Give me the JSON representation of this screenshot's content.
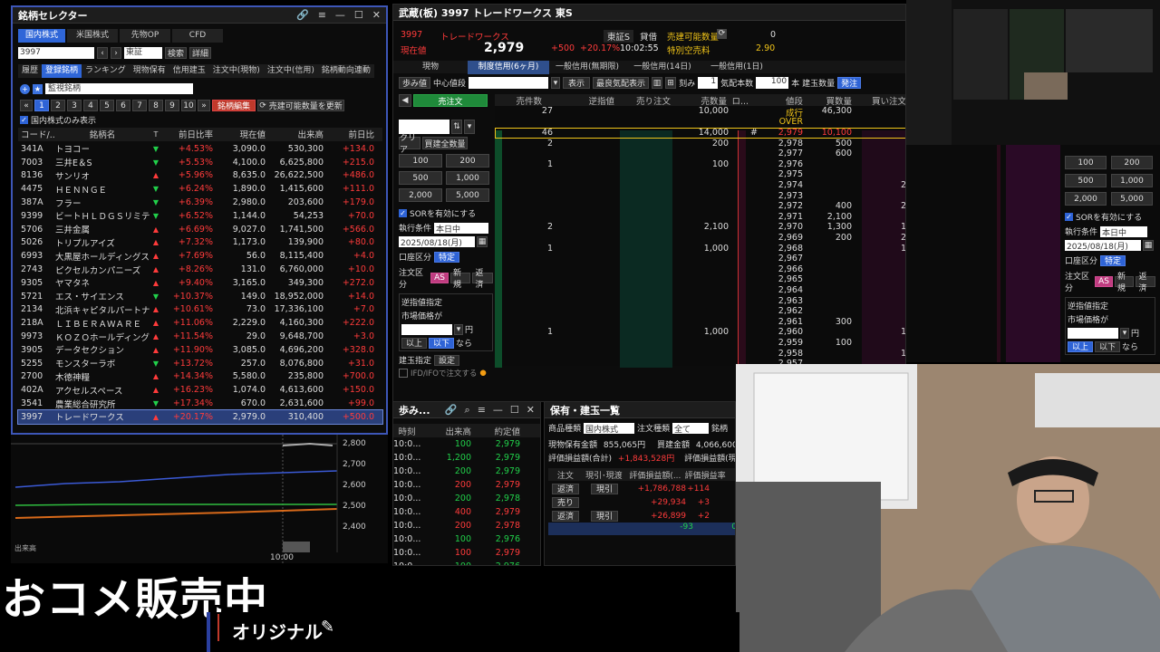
{
  "selector": {
    "title": "銘柄セレクター",
    "tabs": [
      "国内株式",
      "米国株式",
      "先物OP",
      "CFD"
    ],
    "code_input": "3997",
    "market_select": "東証",
    "search_btn": "検索",
    "detail_btn": "詳細",
    "subtabs": [
      "履歴",
      "登録銘柄",
      "ランキング",
      "現物保有",
      "信用建玉",
      "注文中(現物)",
      "注文中(信用)",
      "銘柄動向連動"
    ],
    "list_select": "監視銘柄",
    "pages": [
      "1",
      "2",
      "3",
      "4",
      "5",
      "6",
      "7",
      "8",
      "9",
      "10"
    ],
    "edit_btn": "銘柄編集",
    "refresh_btn": "売建可能数量を更新",
    "domestic_only": "国内株式のみ表示",
    "headers": [
      "コード/...",
      "銘柄名",
      "T",
      "前日比率",
      "現在値",
      "出来高",
      "前日比"
    ],
    "rows": [
      {
        "code": "341A",
        "name": "トヨコー",
        "dir": "down",
        "chg": "+4.53%",
        "price": "3,090.0",
        "vol": "530,300",
        "prev": "+134.0"
      },
      {
        "code": "7003",
        "name": "三井E＆S",
        "dir": "down",
        "chg": "+5.53%",
        "price": "4,100.0",
        "vol": "6,625,800",
        "prev": "+215.0"
      },
      {
        "code": "8136",
        "name": "サンリオ",
        "dir": "up",
        "chg": "+5.96%",
        "price": "8,635.0",
        "vol": "26,622,500",
        "prev": "+486.0"
      },
      {
        "code": "4475",
        "name": "ＨＥＮＮＧＥ",
        "dir": "down",
        "chg": "+6.24%",
        "price": "1,890.0",
        "vol": "1,415,600",
        "prev": "+111.0"
      },
      {
        "code": "387A",
        "name": "フラー",
        "dir": "down",
        "chg": "+6.39%",
        "price": "2,980.0",
        "vol": "203,600",
        "prev": "+179.0"
      },
      {
        "code": "9399",
        "name": "ビートＨＬＤＧＳリミテ...",
        "dir": "down",
        "chg": "+6.52%",
        "price": "1,144.0",
        "vol": "54,253",
        "prev": "+70.0"
      },
      {
        "code": "5706",
        "name": "三井金属",
        "dir": "up",
        "chg": "+6.69%",
        "price": "9,027.0",
        "vol": "1,741,500",
        "prev": "+566.0"
      },
      {
        "code": "5026",
        "name": "トリプルアイズ",
        "dir": "up",
        "chg": "+7.32%",
        "price": "1,173.0",
        "vol": "139,900",
        "prev": "+80.0"
      },
      {
        "code": "6993",
        "name": "大黒屋ホールディングス",
        "dir": "up",
        "chg": "+7.69%",
        "price": "56.0",
        "vol": "8,115,400",
        "prev": "+4.0"
      },
      {
        "code": "2743",
        "name": "ピクセルカンパニーズ",
        "dir": "up",
        "chg": "+8.26%",
        "price": "131.0",
        "vol": "6,760,000",
        "prev": "+10.0"
      },
      {
        "code": "9305",
        "name": "ヤマタネ",
        "dir": "up",
        "chg": "+9.40%",
        "price": "3,165.0",
        "vol": "349,300",
        "prev": "+272.0"
      },
      {
        "code": "5721",
        "name": "エス・サイエンス",
        "dir": "down",
        "chg": "+10.37%",
        "price": "149.0",
        "vol": "18,952,000",
        "prev": "+14.0"
      },
      {
        "code": "2134",
        "name": "北浜キャピタルパートナー...",
        "dir": "up",
        "chg": "+10.61%",
        "price": "73.0",
        "vol": "17,336,100",
        "prev": "+7.0"
      },
      {
        "code": "218A",
        "name": "ＬＩＢＥＲＡＷＡＲＥ",
        "dir": "up",
        "chg": "+11.06%",
        "price": "2,229.0",
        "vol": "4,160,300",
        "prev": "+222.0"
      },
      {
        "code": "9973",
        "name": "ＫＯＺＯホールディングス",
        "dir": "up",
        "chg": "+11.54%",
        "price": "29.0",
        "vol": "9,648,700",
        "prev": "+3.0"
      },
      {
        "code": "3905",
        "name": "データセクション",
        "dir": "up",
        "chg": "+11.90%",
        "price": "3,085.0",
        "vol": "4,696,200",
        "prev": "+328.0"
      },
      {
        "code": "5255",
        "name": "モンスターラボ",
        "dir": "down",
        "chg": "+13.72%",
        "price": "257.0",
        "vol": "8,076,800",
        "prev": "+31.0"
      },
      {
        "code": "2700",
        "name": "木徳神糧",
        "dir": "up",
        "chg": "+14.34%",
        "price": "5,580.0",
        "vol": "235,800",
        "prev": "+700.0"
      },
      {
        "code": "402A",
        "name": "アクセルスペース",
        "dir": "up",
        "chg": "+16.23%",
        "price": "1,074.0",
        "vol": "4,613,600",
        "prev": "+150.0"
      },
      {
        "code": "3541",
        "name": "農業総合研究所",
        "dir": "down",
        "chg": "+17.34%",
        "price": "670.0",
        "vol": "2,631,600",
        "prev": "+99.0"
      },
      {
        "code": "3997",
        "name": "トレードワークス",
        "dir": "up",
        "chg": "+20.17%",
        "price": "2,979.0",
        "vol": "310,400",
        "prev": "+500.0"
      }
    ]
  },
  "minichart": {
    "ticks": [
      "2,800",
      "2,700",
      "2,600",
      "2,500",
      "2,400"
    ],
    "time": "10:00",
    "vol_label": "出来高"
  },
  "board": {
    "title": "武蔵(板) 3997 トレードワークス 東S",
    "code": "3997",
    "name": "トレードワークス",
    "market": "東証S",
    "price_label": "現在値",
    "price": "2,979",
    "change": "+500",
    "change_pct": "+20.17%",
    "time": "10:02:55",
    "lend_label": "貸借",
    "sell_label": "売建可能数量",
    "sell_qty": "0",
    "special_label": "特別空売料",
    "special_rate": "2.90",
    "tabs": [
      "現物",
      "制度信用(6ヶ月)",
      "一般信用(無期限)",
      "一般信用(14日)",
      "一般信用(1日)"
    ],
    "toolbar": {
      "ayumi": "歩み値",
      "center": "中心値段",
      "display": "表示",
      "best": "最良気配表示",
      "step": "刻み",
      "step_val": "1",
      "qty_label": "気配本数",
      "qty_val": "100",
      "unit": "本",
      "close": "建玉数量",
      "oneclick": "発注"
    },
    "sell_order": "売注文",
    "headers": [
      "売件数",
      "逆指値",
      "売り注文",
      "売数量",
      "ロ...",
      "値段",
      "買数量",
      "買い注文"
    ],
    "market_row": {
      "sell_cnt": "27",
      "sell_qty": "10,000",
      "price": "成行",
      "buy_qty": "46,300"
    },
    "over": "OVER",
    "levels": [
      {
        "sc": "46",
        "sq": "14,000",
        "p": "2,979",
        "bq": "10,100"
      },
      {
        "sc": "2",
        "sq": "200",
        "p": "2,978",
        "bq": "500"
      },
      {
        "sc": "",
        "sq": "",
        "p": "2,977",
        "bq": "600"
      },
      {
        "sc": "1",
        "sq": "100",
        "p": "2,976",
        "bq": ""
      },
      {
        "sc": "",
        "sq": "",
        "p": "2,975",
        "bq": ""
      },
      {
        "sc": "",
        "sq": "",
        "p": "2,974",
        "bq": ""
      },
      {
        "sc": "",
        "sq": "",
        "p": "2,973",
        "bq": ""
      },
      {
        "sc": "",
        "sq": "",
        "p": "2,972",
        "bq": "400"
      },
      {
        "sc": "",
        "sq": "",
        "p": "2,971",
        "bq": "2,100"
      },
      {
        "sc": "2",
        "sq": "2,100",
        "p": "2,970",
        "bq": "1,300"
      },
      {
        "sc": "",
        "sq": "",
        "p": "2,969",
        "bq": "200"
      },
      {
        "sc": "1",
        "sq": "1,000",
        "p": "2,968",
        "bq": ""
      },
      {
        "sc": "",
        "sq": "",
        "p": "2,967",
        "bq": ""
      },
      {
        "sc": "",
        "sq": "",
        "p": "2,966",
        "bq": ""
      },
      {
        "sc": "",
        "sq": "",
        "p": "2,965",
        "bq": ""
      },
      {
        "sc": "",
        "sq": "",
        "p": "2,964",
        "bq": ""
      },
      {
        "sc": "",
        "sq": "",
        "p": "2,963",
        "bq": ""
      },
      {
        "sc": "",
        "sq": "",
        "p": "2,962",
        "bq": ""
      },
      {
        "sc": "",
        "sq": "",
        "p": "2,961",
        "bq": "300"
      },
      {
        "sc": "1",
        "sq": "1,000",
        "p": "2,960",
        "bq": ""
      },
      {
        "sc": "",
        "sq": "",
        "p": "2,959",
        "bq": "100"
      },
      {
        "sc": "",
        "sq": "",
        "p": "2,958",
        "bq": ""
      },
      {
        "sc": "",
        "sq": "",
        "p": "2,957",
        "bq": ""
      }
    ],
    "buy_cnt": [
      "2",
      "2",
      "1",
      "2",
      "1",
      "1",
      "1"
    ],
    "clear_btn": "クリア",
    "all_qty_btn": "買建全数量",
    "qty_btns": [
      "100",
      "200",
      "500",
      "1,000",
      "2,000",
      "5,000"
    ],
    "sor": "SORを有効にする",
    "cond_label": "執行条件",
    "cond_val": "本日中",
    "date_val": "2025/08/18(月)",
    "acct_label": "口座区分",
    "acct_val": "特定",
    "ord_label": "注文区分",
    "ord_as": "AS",
    "ord_new": "新規",
    "ord_close": "返済",
    "stop_label": "逆指値指定",
    "mkt_price": "市場価格が",
    "yen": "円",
    "above": "以上",
    "below": "以下",
    "nara": "なら",
    "pos_label": "建玉指定",
    "pos_btn": "設定",
    "ifd": "IFD/IFOで注文する"
  },
  "ticks": {
    "title": "歩み...",
    "headers": [
      "時刻",
      "出来高",
      "約定値"
    ],
    "rows": [
      {
        "t": "10:0...",
        "v": "100",
        "p": "2,979",
        "c": "green"
      },
      {
        "t": "10:0...",
        "v": "1,200",
        "p": "2,979",
        "c": "green"
      },
      {
        "t": "10:0...",
        "v": "200",
        "p": "2,979",
        "c": "green"
      },
      {
        "t": "10:0...",
        "v": "200",
        "p": "2,979",
        "c": "red"
      },
      {
        "t": "10:0...",
        "v": "200",
        "p": "2,978",
        "c": "green"
      },
      {
        "t": "10:0...",
        "v": "400",
        "p": "2,979",
        "c": "red"
      },
      {
        "t": "10:0...",
        "v": "200",
        "p": "2,978",
        "c": "red"
      },
      {
        "t": "10:0...",
        "v": "100",
        "p": "2,976",
        "c": "green"
      },
      {
        "t": "10:0...",
        "v": "100",
        "p": "2,979",
        "c": "red"
      },
      {
        "t": "10:0...",
        "v": "100",
        "p": "2,976",
        "c": "green"
      }
    ]
  },
  "holdings": {
    "title": "保有・建玉一覧",
    "kind_label": "商品種類",
    "kind_val": "国内株式",
    "ordtype_label": "注文種類",
    "ordtype_val": "全て",
    "stock_label": "銘柄",
    "cash_label": "現物保有金額",
    "cash_val": "855,065円",
    "buy_label": "買建金額",
    "buy_val": "4,066,600",
    "pl_label": "評価損益額(合計)",
    "pl_val": "+1,843,528円",
    "pl_label2": "評価損益額(現",
    "headers": [
      "注文",
      "現引･現渡",
      "評価損益額(...",
      "評価損益率"
    ],
    "rows": [
      {
        "a": "返済",
        "b": "現引",
        "c": "+1,786,788",
        "d": "+114"
      },
      {
        "a": "売り",
        "b": "",
        "c": "+29,934",
        "d": "+3"
      },
      {
        "a": "返済",
        "b": "現引",
        "c": "+26,899",
        "d": "+2"
      }
    ],
    "total": "-93",
    "total2": "0"
  },
  "caption": {
    "main": "おコメ販売中",
    "sub": "オリジナル"
  }
}
